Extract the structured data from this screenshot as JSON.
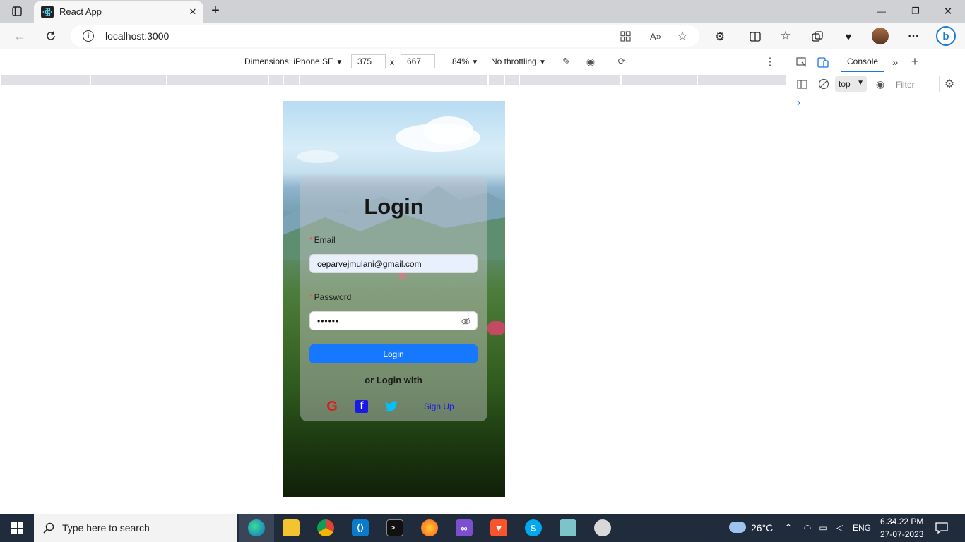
{
  "browser": {
    "tab_title": "React App",
    "url": "localhost:3000",
    "new_tab_label": "+",
    "minimize_label": "—",
    "restore_label": "❐",
    "close_label": "✕"
  },
  "devtools": {
    "dimensions_label": "Dimensions: iPhone SE",
    "width": "375",
    "height": "667",
    "times": "x",
    "zoom": "84%",
    "throttling": "No throttling",
    "console_tab": "Console",
    "context": "top",
    "filter_placeholder": "Filter",
    "prompt": "›"
  },
  "login": {
    "title": "Login",
    "email_label": "Email",
    "email_value": "ceparvejmulani@gmail.com",
    "password_label": "Password",
    "password_value": "••••••",
    "required_mark": "*",
    "login_button": "Login",
    "divider_text": "or Login with",
    "google": "G",
    "facebook": "f",
    "signup": "Sign Up"
  },
  "taskbar": {
    "search_placeholder": "Type here to search",
    "weather": "26°C",
    "language": "ENG",
    "time": "6.34.22 PM",
    "date": "27-07-2023"
  },
  "colors": {
    "primary": "#1677ff",
    "google": "#e01b1b",
    "facebook": "#1a1ae6",
    "twitter": "#00c2ff",
    "required": "#ff4d4f"
  }
}
